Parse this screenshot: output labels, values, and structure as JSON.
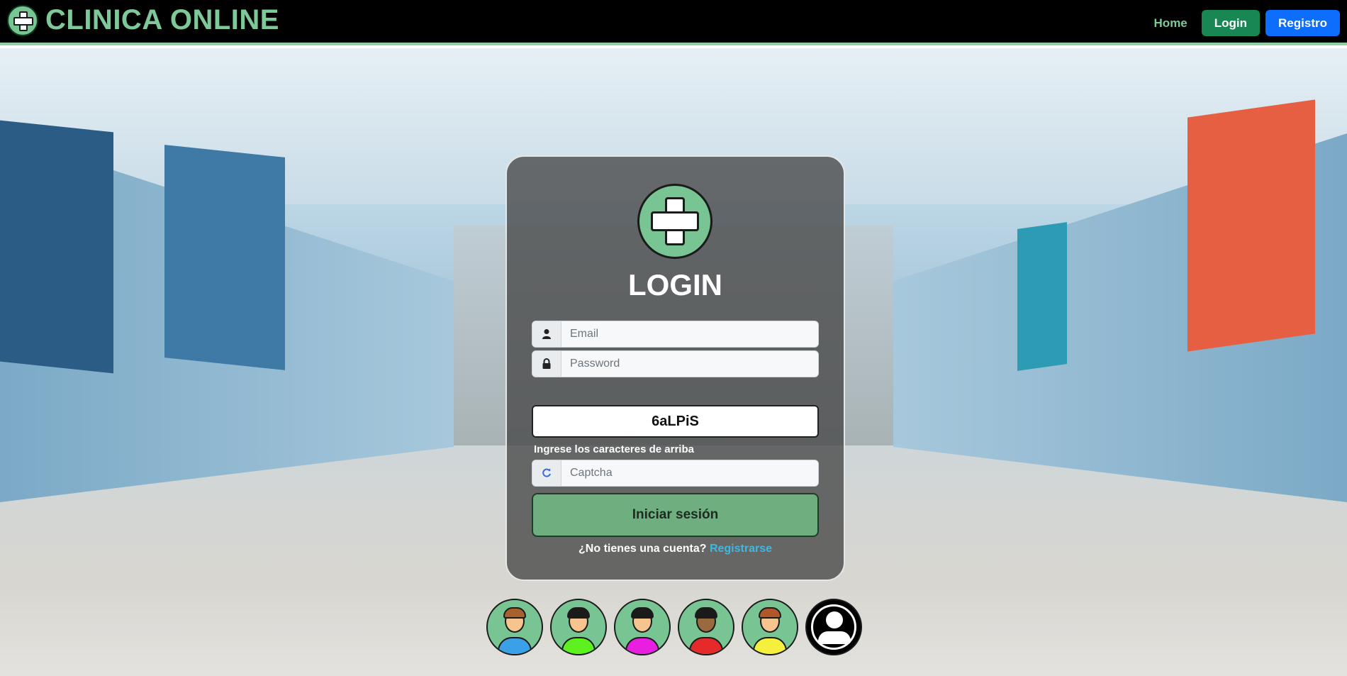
{
  "navbar": {
    "brand": "CLINICA ONLINE",
    "home": "Home",
    "login": "Login",
    "registro": "Registro"
  },
  "login_card": {
    "title": "LOGIN",
    "email_placeholder": "Email",
    "password_placeholder": "Password",
    "captcha_text": "6aLPiS",
    "captcha_help": "Ingrese los caracteres de arriba",
    "captcha_placeholder": "Captcha",
    "submit_label": "Iniciar sesión",
    "signup_question": "¿No tienes una cuenta?",
    "signup_link": "Registrarse"
  },
  "icons": {
    "email": "user-icon",
    "password": "lock-icon",
    "captcha": "refresh-icon"
  },
  "quick_users": [
    {
      "shirt": "#3aa0e8",
      "hair": "#a8612c"
    },
    {
      "shirt": "#5cf11f",
      "hair": "#1a1a1a"
    },
    {
      "shirt": "#e81fe0",
      "hair": "#1a1a1a"
    },
    {
      "shirt": "#e52a2a",
      "hair": "#1a1a1a"
    },
    {
      "shirt": "#f4f03d",
      "hair": "#b0582a"
    },
    {
      "type": "admin"
    }
  ],
  "colors": {
    "brand_green": "#7ec99a",
    "login_button": "#198754",
    "registro_button": "#0d6efd",
    "link": "#3fb8e0"
  }
}
